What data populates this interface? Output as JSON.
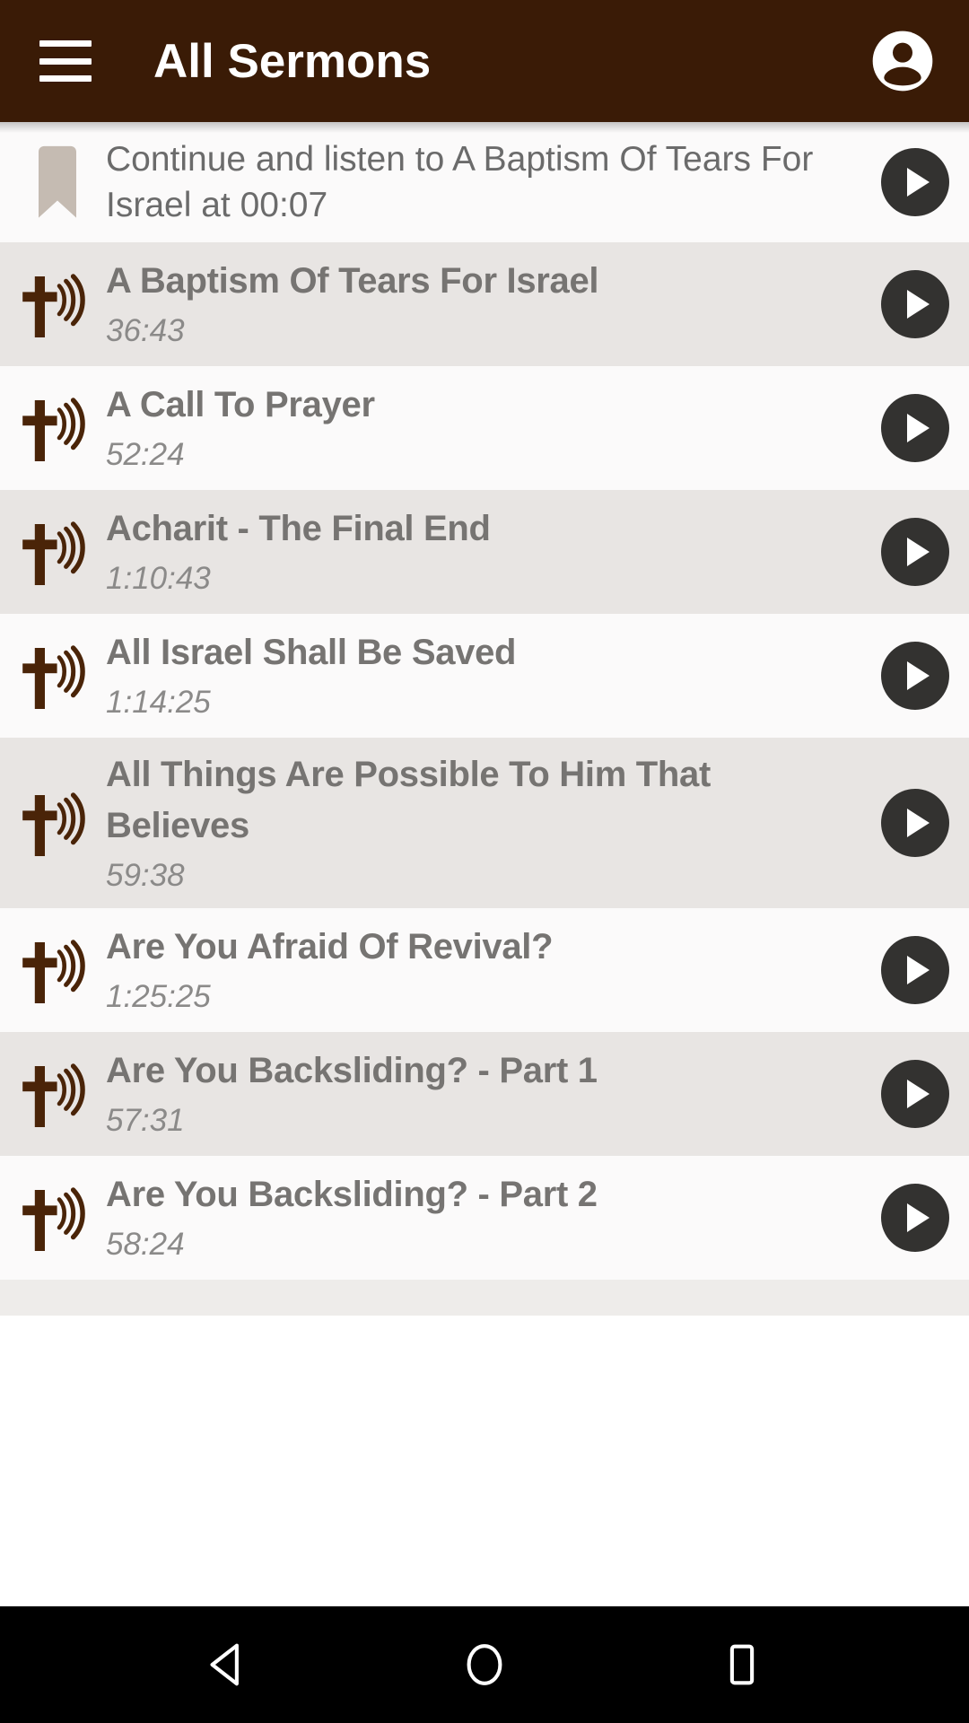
{
  "appbar": {
    "menu_icon": "hamburger-menu-icon",
    "title": "All Sermons",
    "avatar_icon": "account-circle-icon",
    "background_color": "#3a1b06",
    "text_color": "#ffffff"
  },
  "continue_banner": {
    "bookmark_icon": "bookmark-icon",
    "bookmark_color": "#c5bbb2",
    "text": "Continue and listen to A Baptism Of Tears For Israel at 00:07",
    "play_icon": "play-circle-icon"
  },
  "list": {
    "row_icon": "cross-audio-icon",
    "row_icon_color": "#4a2408",
    "play_icon": "play-circle-icon",
    "play_button_color": "#333230",
    "stripe_colors": [
      "#e8e5e3",
      "#fbfafa"
    ],
    "items": [
      {
        "title": "A Baptism Of Tears For Israel",
        "duration": "36:43"
      },
      {
        "title": "A Call To Prayer",
        "duration": "52:24"
      },
      {
        "title": "Acharit - The Final End",
        "duration": "1:10:43"
      },
      {
        "title": "All Israel Shall Be Saved",
        "duration": "1:14:25"
      },
      {
        "title": "All Things Are Possible To Him That Believes",
        "duration": "59:38"
      },
      {
        "title": "Are You Afraid Of Revival?",
        "duration": "1:25:25"
      },
      {
        "title": "Are You Backsliding? - Part 1",
        "duration": "57:31"
      },
      {
        "title": "Are You Backsliding? - Part 2",
        "duration": "58:24"
      }
    ]
  },
  "navbar": {
    "back_icon": "back-triangle-icon",
    "home_icon": "home-circle-icon",
    "recents_icon": "recents-square-icon",
    "background_color": "#000000"
  }
}
